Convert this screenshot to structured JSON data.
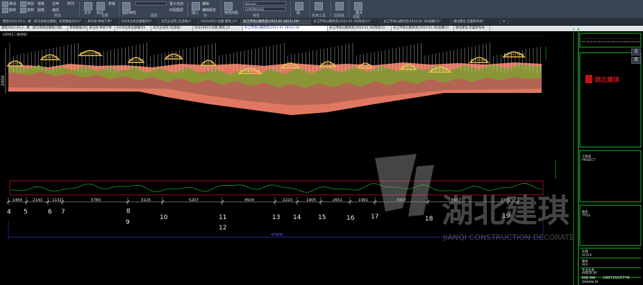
{
  "ribbon": {
    "buttons": {
      "move": "移动",
      "rotate": "旋转",
      "trim": "修剪",
      "copy": "复制",
      "mirror": "镜像",
      "fillet": "圆角",
      "stretch": "拉伸",
      "scale": "缩放",
      "array": "阵列",
      "text": "文字",
      "dimension": "标注",
      "table": "表格",
      "layer_props": "图层特性",
      "make_current": "置为当前",
      "match_layer": "匹配图层",
      "insert": "插入",
      "edit": "编辑",
      "edit_attr": "编辑属性",
      "match_props": "特性匹配",
      "group": "组",
      "utilities": "实用工具",
      "clipboard": "剪贴板",
      "view": "视图",
      "base": "基点"
    },
    "combos": {
      "color": "ByLayer",
      "linetype": "CONTINUOUS"
    },
    "sections": {
      "modify": "修改",
      "annotation": "注释",
      "layers": "图层",
      "block": "块",
      "properties": "特性",
      "groups": "组",
      "utilities": "实用工具",
      "clipboard": "剪贴板",
      "view": "视图"
    }
  },
  "tabs_top": [
    "建筑2022.03.2...楼（某马场商业楼施工图）*",
    "装修图纸2022*",
    "某马场 林地下单*",
    "0316立体主题展示2*",
    "天元五号院 (信息板)*",
    "20210923-也图·建筑_t3*",
    "长江市场公路改造(2012.01.18)(1).18*",
    "长江市场公路改造(2012.01.18)改造(1)*",
    "长江市场公路改造(2012.01.18)加图(1)*",
    "湖北建设 店面新布局*"
  ],
  "tabs_second": [
    "建筑2022.03.2...楼（某马场商业楼施工图）",
    "装修图纸2022",
    "某马场 林地下单",
    "0316立体主题展示2",
    "天元五号院 (信息板)",
    "20210923-也图·建筑_t3",
    "长江市场公路改造(2012.01.18)(1).18",
    "长江市场公路改造(2012.01.18)改造(1)",
    "长江市场公路改造(2012.01.18)加图(1)",
    "湖北建设 店面新布局"
  ],
  "view_label": "-][俯视][二维线框]",
  "drawing": {
    "height_dim": "2000",
    "segment_dims": [
      "1464",
      "2143",
      "1132",
      "5780",
      "3125",
      "5207",
      "4504",
      "2223",
      "1905",
      "2651",
      "1991",
      "4907",
      "8657",
      "3381"
    ],
    "node_numbers": [
      "4",
      "5",
      "6",
      "7",
      "8",
      "9",
      "10",
      "11",
      "12",
      "13",
      "14",
      "15",
      "16",
      "17",
      "18",
      "19"
    ],
    "total_dim": "47900"
  },
  "watermark": {
    "name": "湖北建琪",
    "sub": "JIANQI CONSTRUCTION DECORATE"
  },
  "title_block": {
    "project_label": "工程名",
    "project_en": "PROJECT",
    "title_label": "图名",
    "title_en": "TITLE",
    "scale_label": "比例",
    "scale_en": "SCALE",
    "rev_label": "版本",
    "rev_en": "REV",
    "major_label": "专业负责",
    "major_en": "MAJOR BY",
    "drawn_label": "制图 徐枫",
    "drawn_phone": "18972555778",
    "drawn_en": "DRAWN BY",
    "header_note": "the owner and shall not be reproduced without permission",
    "logo_text": "湖北建琪"
  },
  "nav": {
    "up": "北",
    "down": "南"
  },
  "colors": {
    "ribbon_bg": "#3b4453",
    "canvas_bg": "#000000",
    "terrain_olive": "#8a9635",
    "terrain_clay": "#b46452",
    "terrain_salmon": "#e07861",
    "gold": "#f0c050",
    "grid_green": "#1fb82a",
    "frame_red": "#c0141e",
    "dim_blue": "#2f3ccf"
  }
}
